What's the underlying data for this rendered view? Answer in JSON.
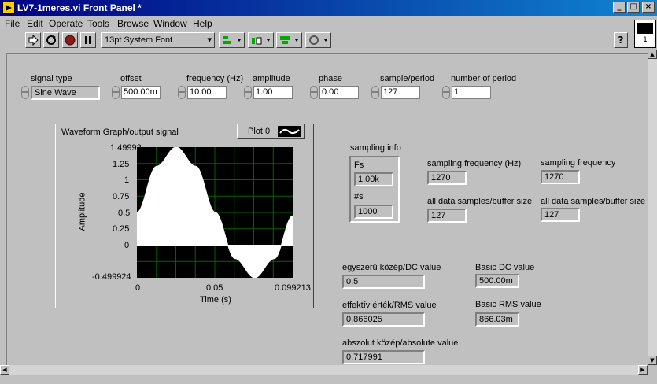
{
  "window": {
    "title": "LV7-1meres.vi Front Panel *"
  },
  "titlebar_buttons": [
    "_",
    "□",
    "×"
  ],
  "menu": [
    "File",
    "Edit",
    "Operate",
    "Tools",
    "Browse",
    "Window",
    "Help"
  ],
  "toolbar": {
    "font_select": "13pt System Font",
    "help_label": "?",
    "connector_label": "1"
  },
  "controls": {
    "signal_type": {
      "label": "signal type",
      "value": "Sine Wave"
    },
    "offset": {
      "label": "offset",
      "value": "500.00m"
    },
    "frequency": {
      "label": "frequency (Hz)",
      "value": "10.00"
    },
    "amplitude": {
      "label": "amplitude",
      "value": "1.00"
    },
    "phase": {
      "label": "phase",
      "value": "0.00"
    },
    "sample_period": {
      "label": "sample/period",
      "value": "127"
    },
    "number_of_period": {
      "label": "number of period",
      "value": "1"
    }
  },
  "graph": {
    "title": "Waveform Graph/output signal",
    "plot_legend": "Plot 0",
    "xlabel": "Time (s)",
    "ylabel": "Amplitude",
    "y_ticks": [
      "1.49992",
      "1.25",
      "1",
      "0.75",
      "0.5",
      "0.25",
      "0",
      "-0.499924"
    ],
    "x_ticks": [
      "0",
      "0.05",
      "0.099213"
    ]
  },
  "chart_data": {
    "type": "area",
    "title": "Waveform Graph/output signal",
    "xlabel": "Time (s)",
    "ylabel": "Amplitude",
    "xlim": [
      0,
      0.099213
    ],
    "ylim": [
      -0.499924,
      1.49992
    ],
    "series": [
      {
        "name": "Plot 0",
        "x": [
          0,
          0.0125,
          0.025,
          0.0375,
          0.05,
          0.0625,
          0.075,
          0.0875,
          0.099213
        ],
        "y": [
          0.5,
          1.207,
          1.5,
          1.207,
          0.5,
          -0.207,
          -0.5,
          -0.207,
          0.45
        ]
      }
    ],
    "grid": true
  },
  "sampling_info": {
    "title": "sampling info",
    "fs_label": "Fs",
    "fs_value": "1.00k",
    "ns_label": "#s",
    "ns_value": "1000"
  },
  "indicators": {
    "sampling_frequency_hz": {
      "label": "sampling frequency  (Hz)",
      "value": "1270"
    },
    "sampling_frequency": {
      "label": "sampling frequency",
      "value": "1270"
    },
    "all_samples_1": {
      "label": "all data samples/buffer size",
      "value": "127"
    },
    "all_samples_2": {
      "label": "all data samples/buffer size",
      "value": "127"
    },
    "dc": {
      "label": "egyszerű közép/DC value",
      "value": "0.5"
    },
    "basic_dc": {
      "label": "Basic DC value",
      "value": "500.00m"
    },
    "rms": {
      "label": "effektív érték/RMS value",
      "value": "0.866025"
    },
    "basic_rms": {
      "label": "Basic RMS value",
      "value": "866.03m"
    },
    "abs": {
      "label": "abszolut közép/absolute value",
      "value": "0.717991"
    }
  }
}
